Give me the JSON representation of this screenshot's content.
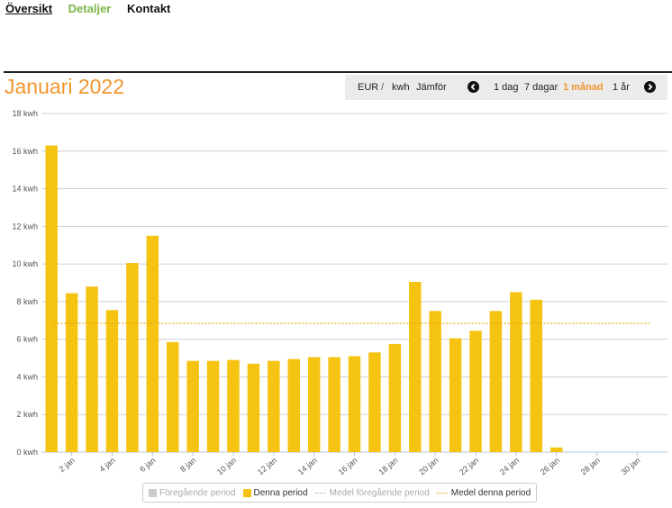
{
  "nav": {
    "overview": "Översikt",
    "details": "Detaljer",
    "contact": "Kontakt"
  },
  "title": "Januari 2022",
  "toolbar": {
    "eur": "EUR",
    "sep": "/",
    "kwh": "kwh",
    "compare": "Jämför",
    "day": "1 dag",
    "week": "7 dagar",
    "month": "1 månad",
    "year": "1 år"
  },
  "legend": {
    "prev_period": "Föregående period",
    "this_period": "Denna period",
    "avg_prev": "Medel föregående period",
    "avg_this": "Medel denna period"
  },
  "colors": {
    "bar": "#f5c311",
    "avg_line": "#e6a817",
    "accent": "#f0962e",
    "grid": "#d0d0d0"
  },
  "chart_data": {
    "type": "bar",
    "ylim": [
      0,
      18
    ],
    "yticks": [
      0,
      2,
      4,
      6,
      8,
      10,
      12,
      14,
      16,
      18
    ],
    "yunit": "kwh",
    "categories": [
      "1 jan",
      "2 jan",
      "3 jan",
      "4 jan",
      "5 jan",
      "6 jan",
      "7 jan",
      "8 jan",
      "9 jan",
      "10 jan",
      "11 jan",
      "12 jan",
      "13 jan",
      "14 jan",
      "15 jan",
      "16 jan",
      "17 jan",
      "18 jan",
      "19 jan",
      "20 jan",
      "21 jan",
      "22 jan",
      "23 jan",
      "24 jan",
      "25 jan",
      "26 jan",
      "27 jan",
      "28 jan",
      "29 jan",
      "30 jan",
      "31 jan"
    ],
    "xtick_labels": [
      "2 jan",
      "4 jan",
      "6 jan",
      "8 jan",
      "10 jan",
      "12 jan",
      "14 jan",
      "16 jan",
      "18 jan",
      "20 jan",
      "22 jan",
      "24 jan",
      "26 jan",
      "28 jan",
      "30 jan"
    ],
    "series": [
      {
        "name": "Denna period",
        "values": [
          16.3,
          8.45,
          8.8,
          7.55,
          10.05,
          11.5,
          5.85,
          4.85,
          4.85,
          4.9,
          4.7,
          4.85,
          4.95,
          5.05,
          5.05,
          5.1,
          5.3,
          5.75,
          9.05,
          7.5,
          6.05,
          6.45,
          7.5,
          8.5,
          8.1,
          0.25,
          0,
          0,
          0,
          0,
          0
        ]
      }
    ],
    "average_this_period": 6.85
  }
}
